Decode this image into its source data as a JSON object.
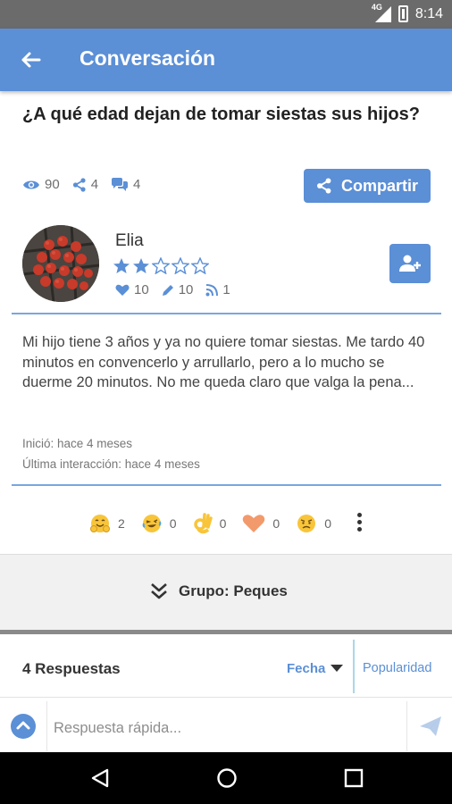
{
  "status_bar": {
    "network": "4G",
    "time": "8:14"
  },
  "app_bar": {
    "title": "Conversación",
    "back_icon": "arrow-left-icon"
  },
  "question": {
    "title": "¿A qué edad dejan de tomar siestas sus hijos?"
  },
  "stats": {
    "views": "90",
    "shares": "4",
    "comments": "4"
  },
  "share_button": {
    "label": "Compartir"
  },
  "author": {
    "name": "Elia",
    "rating": 2,
    "rating_max": 5,
    "likes": "10",
    "posts": "10",
    "followers": "1"
  },
  "post": {
    "body": "Mi hijo tiene 3 años y ya no quiere tomar siestas. Me tardo 40 minutos en convencerlo y arrullarlo, pero a lo mucho se duerme 20 minutos. No me queda claro que valga la pena...",
    "started": "Inició: hace 4 meses",
    "last_interaction": "Última interacción: hace 4 meses"
  },
  "reactions": [
    {
      "icon": "hug-emoji-icon",
      "count": "2"
    },
    {
      "icon": "laughing-emoji-icon",
      "count": "0"
    },
    {
      "icon": "ok-hand-icon",
      "count": "0"
    },
    {
      "icon": "heart-icon",
      "count": "0"
    },
    {
      "icon": "worried-emoji-icon",
      "count": "0"
    }
  ],
  "group": {
    "label": "Grupo: Peques"
  },
  "replies": {
    "count_label": "4 Respuestas",
    "sort_date": "Fecha",
    "sort_popularity": "Popularidad"
  },
  "quick_reply": {
    "placeholder": "Respuesta rápida..."
  },
  "colors": {
    "accent": "#5b8fd6",
    "status_bar": "#6b6b6b",
    "nav_bar": "#000000"
  }
}
